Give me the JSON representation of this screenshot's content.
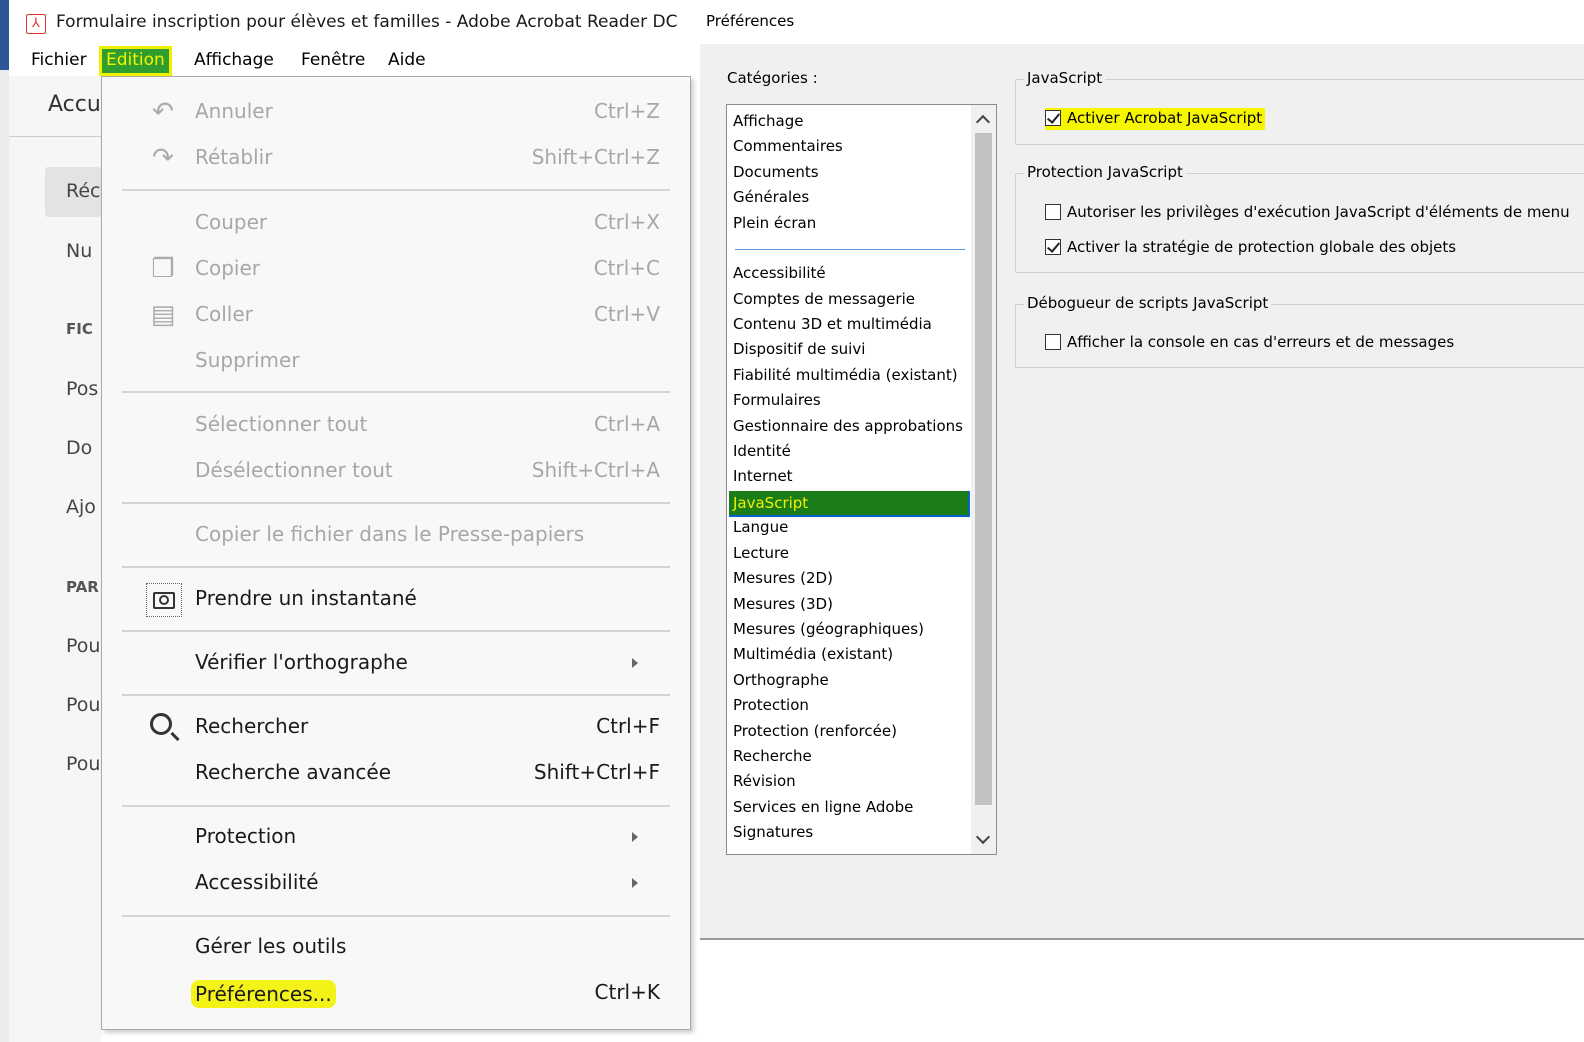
{
  "app": {
    "title": "Formulaire inscription pour élèves et familles - Adobe Acrobat Reader DC",
    "menu": [
      "Fichier",
      "Edition",
      "Affichage",
      "Fenêtre",
      "Aide"
    ],
    "active_menu": "Edition",
    "background": {
      "tab": "Accu",
      "items": [
        "Réc",
        "Nu",
        "FIC",
        "Pos",
        "Do",
        "Ajo",
        "PAR",
        "Pou",
        "Pou",
        "Pou"
      ]
    }
  },
  "edit_menu": {
    "items": [
      {
        "label": "Annuler",
        "shortcut": "Ctrl+Z",
        "enabled": false,
        "icon": "undo-icon"
      },
      {
        "label": "Rétablir",
        "shortcut": "Shift+Ctrl+Z",
        "enabled": false,
        "icon": "redo-icon"
      },
      {
        "label": "Couper",
        "shortcut": "Ctrl+X",
        "enabled": false
      },
      {
        "label": "Copier",
        "shortcut": "Ctrl+C",
        "enabled": false,
        "icon": "copy-icon"
      },
      {
        "label": "Coller",
        "shortcut": "Ctrl+V",
        "enabled": false,
        "icon": "paste-icon"
      },
      {
        "label": "Supprimer",
        "shortcut": "",
        "enabled": false
      },
      {
        "label": "Sélectionner tout",
        "shortcut": "Ctrl+A",
        "enabled": false
      },
      {
        "label": "Désélectionner tout",
        "shortcut": "Shift+Ctrl+A",
        "enabled": false
      },
      {
        "label": "Copier le fichier dans le Presse-papiers",
        "shortcut": "",
        "enabled": false
      },
      {
        "label": "Prendre un instantané",
        "shortcut": "",
        "enabled": true,
        "icon": "camera-icon"
      },
      {
        "label": "Vérifier l'orthographe",
        "shortcut": "",
        "enabled": true,
        "submenu": true
      },
      {
        "label": "Rechercher",
        "shortcut": "Ctrl+F",
        "enabled": true,
        "icon": "search-icon"
      },
      {
        "label": "Recherche avancée",
        "shortcut": "Shift+Ctrl+F",
        "enabled": true
      },
      {
        "label": "Protection",
        "shortcut": "",
        "enabled": true,
        "submenu": true
      },
      {
        "label": "Accessibilité",
        "shortcut": "",
        "enabled": true,
        "submenu": true
      },
      {
        "label": "Gérer les outils",
        "shortcut": "",
        "enabled": true
      },
      {
        "label": "Préférences...",
        "shortcut": "Ctrl+K",
        "enabled": true,
        "highlighted": true
      }
    ]
  },
  "prefs": {
    "title": "Préférences",
    "categories_label": "Catégories :",
    "categories_top": [
      "Affichage",
      "Commentaires",
      "Documents",
      "Générales",
      "Plein écran"
    ],
    "categories": [
      "Accessibilité",
      "Comptes de messagerie",
      "Contenu 3D et multimédia",
      "Dispositif de suivi",
      "Fiabilité multimédia (existant)",
      "Formulaires",
      "Gestionnaire des approbations",
      "Identité",
      "Internet",
      "JavaScript",
      "Langue",
      "Lecture",
      "Mesures (2D)",
      "Mesures (3D)",
      "Mesures (géographiques)",
      "Multimédia (existant)",
      "Orthographe",
      "Protection",
      "Protection (renforcée)",
      "Recherche",
      "Révision",
      "Services en ligne Adobe",
      "Signatures"
    ],
    "selected_category": "JavaScript",
    "groups": [
      {
        "legend": "JavaScript",
        "options": [
          {
            "label": "Activer Acrobat JavaScript",
            "checked": true,
            "highlighted": true
          }
        ]
      },
      {
        "legend": "Protection JavaScript",
        "options": [
          {
            "label": "Autoriser les privilèges d'exécution JavaScript d'éléments de menu",
            "checked": false
          },
          {
            "label": "Activer la stratégie de protection globale des objets",
            "checked": true
          }
        ]
      },
      {
        "legend": "Débogueur de scripts JavaScript",
        "options": [
          {
            "label": "Afficher la console en cas d'erreurs et de messages",
            "checked": false
          }
        ]
      }
    ]
  },
  "colors": {
    "highlight_yellow": "#f3f318",
    "selection_green": "#1a7d1a",
    "menu_active_green": "#2f9d2f"
  }
}
